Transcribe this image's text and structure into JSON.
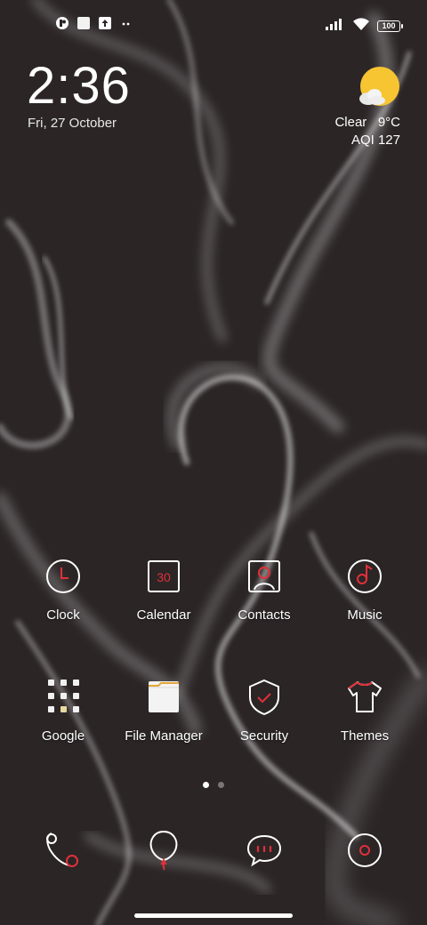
{
  "status_bar": {
    "left_icons": [
      "notification-app-icon",
      "notification-square-icon",
      "upload-icon",
      "more-dots-icon"
    ],
    "right_icons": [
      "signal-icon",
      "wifi-icon"
    ],
    "battery_level": "100"
  },
  "clock_widget": {
    "time": "2:36",
    "date": "Fri, 27 October"
  },
  "weather_widget": {
    "icon": "partly-cloudy-icon",
    "condition": "Clear",
    "temperature": "9°C",
    "aqi": "AQI 127"
  },
  "apps": [
    {
      "label": "Clock",
      "icon": "clock-icon"
    },
    {
      "label": "Calendar",
      "icon": "calendar-icon",
      "icon_text": "30"
    },
    {
      "label": "Contacts",
      "icon": "contacts-icon"
    },
    {
      "label": "Music",
      "icon": "music-icon"
    },
    {
      "label": "Google",
      "icon": "google-folder-icon"
    },
    {
      "label": "File Manager",
      "icon": "folder-icon"
    },
    {
      "label": "Security",
      "icon": "shield-check-icon"
    },
    {
      "label": "Themes",
      "icon": "tshirt-icon"
    }
  ],
  "page_indicator": {
    "total": 2,
    "current": 1
  },
  "dock": [
    {
      "icon": "phone-icon"
    },
    {
      "icon": "browser-balloon-icon"
    },
    {
      "icon": "messages-icon"
    },
    {
      "icon": "camera-icon"
    }
  ],
  "colors": {
    "accent_red": "#e0303a",
    "icon_stroke": "#ffffff",
    "background": "#2b2526",
    "weather_sun": "#f7c531"
  }
}
